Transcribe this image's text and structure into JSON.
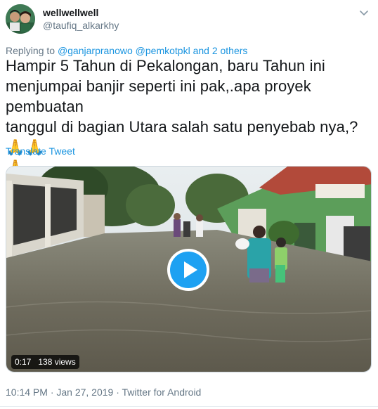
{
  "author": {
    "display_name": "wellwellwell",
    "handle": "@taufiq_alkarkhy"
  },
  "reply": {
    "prefix": "Replying to",
    "mentions": "@ganjarpranowo @pemkotpkl and 2 others"
  },
  "tweet": {
    "line1": "Hampir 5 Tahun di Pekalongan, baru Tahun ini",
    "line2": "menjumpai banjir seperti ini pak,.apa proyek pembuatan",
    "line3": "tanggul di bagian Utara salah satu penyebab nya,?🙏🙏",
    "line4": "🙏",
    "translate_label": "Translate Tweet"
  },
  "media": {
    "duration": "0:17",
    "views": "138 views"
  },
  "meta": {
    "timestamp": "10:14 PM · Jan 27, 2019 · Twitter for Android"
  },
  "colors": {
    "link": "#1b95e0",
    "secondary_text": "#657786",
    "play_button": "#1da1f2"
  }
}
